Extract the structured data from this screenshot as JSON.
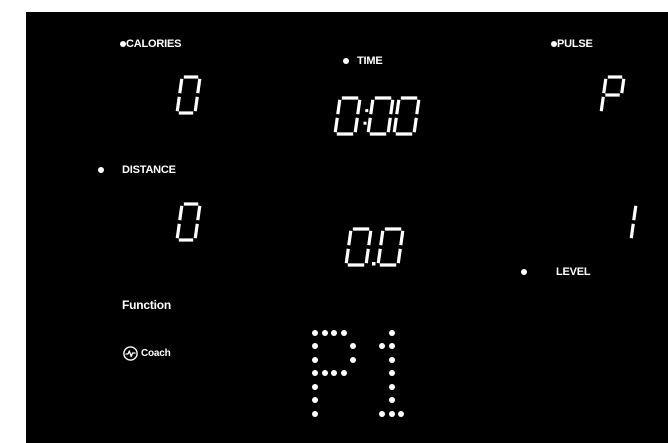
{
  "console": {
    "labels": {
      "calories": "CALORIES",
      "time": "TIME",
      "pulse": "PULSE",
      "distance": "DISTANCE",
      "level": "LEVEL",
      "function": "Function",
      "coach": "Coach"
    },
    "readouts": {
      "calories": "0",
      "time": "0:00",
      "pulse": "P",
      "distance": "0",
      "speed": "0.0",
      "level": "1"
    },
    "program_display": "P1",
    "icons": [
      "heartbeat-icon",
      "indicator-dot"
    ],
    "colors": {
      "background": "#000000",
      "segments": "#ffffff"
    }
  }
}
